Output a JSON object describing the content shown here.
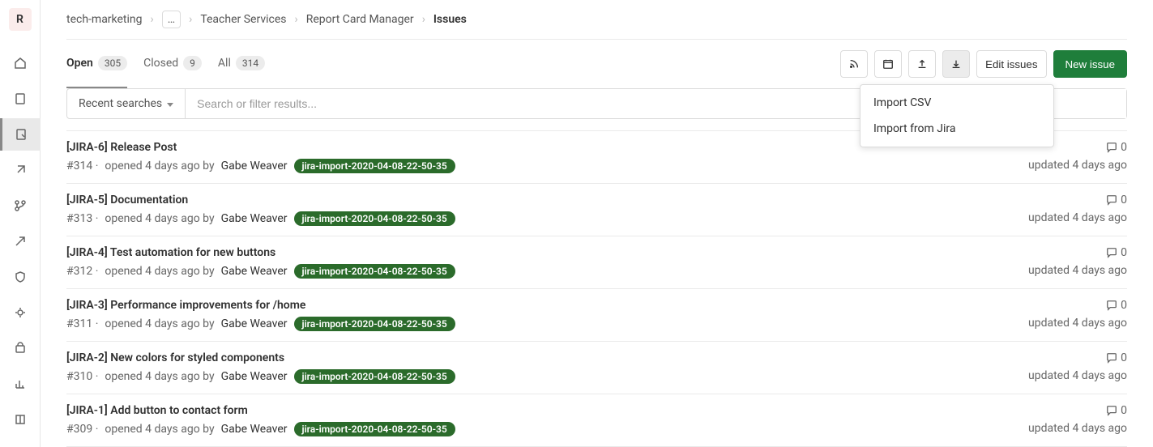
{
  "sidebar": {
    "project_letter": "R"
  },
  "breadcrumb": {
    "items": [
      "tech-marketing",
      "Teacher Services",
      "Report Card Manager"
    ],
    "current": "Issues",
    "more_label": "…"
  },
  "tabs": {
    "open": {
      "label": "Open",
      "count": "305"
    },
    "closed": {
      "label": "Closed",
      "count": "9"
    },
    "all": {
      "label": "All",
      "count": "314"
    }
  },
  "actions": {
    "edit_issues": "Edit issues",
    "new_issue": "New issue",
    "import_menu": {
      "csv": "Import CSV",
      "jira": "Import from Jira"
    }
  },
  "filter": {
    "recent": "Recent searches",
    "placeholder": "Search or filter results..."
  },
  "issues": [
    {
      "title": "[JIRA-6] Release Post",
      "ref": "#314",
      "opened": "opened 4 days ago by",
      "author": "Gabe Weaver",
      "label": "jira-import-2020-04-08-22-50-35",
      "comments": "0",
      "updated": "updated 4 days ago"
    },
    {
      "title": "[JIRA-5] Documentation",
      "ref": "#313",
      "opened": "opened 4 days ago by",
      "author": "Gabe Weaver",
      "label": "jira-import-2020-04-08-22-50-35",
      "comments": "0",
      "updated": "updated 4 days ago"
    },
    {
      "title": "[JIRA-4] Test automation for new buttons",
      "ref": "#312",
      "opened": "opened 4 days ago by",
      "author": "Gabe Weaver",
      "label": "jira-import-2020-04-08-22-50-35",
      "comments": "0",
      "updated": "updated 4 days ago"
    },
    {
      "title": "[JIRA-3] Performance improvements for /home",
      "ref": "#311",
      "opened": "opened 4 days ago by",
      "author": "Gabe Weaver",
      "label": "jira-import-2020-04-08-22-50-35",
      "comments": "0",
      "updated": "updated 4 days ago"
    },
    {
      "title": "[JIRA-2] New colors for styled components",
      "ref": "#310",
      "opened": "opened 4 days ago by",
      "author": "Gabe Weaver",
      "label": "jira-import-2020-04-08-22-50-35",
      "comments": "0",
      "updated": "updated 4 days ago"
    },
    {
      "title": "[JIRA-1] Add button to contact form",
      "ref": "#309",
      "opened": "opened 4 days ago by",
      "author": "Gabe Weaver",
      "label": "jira-import-2020-04-08-22-50-35",
      "comments": "0",
      "updated": "updated 4 days ago"
    }
  ]
}
